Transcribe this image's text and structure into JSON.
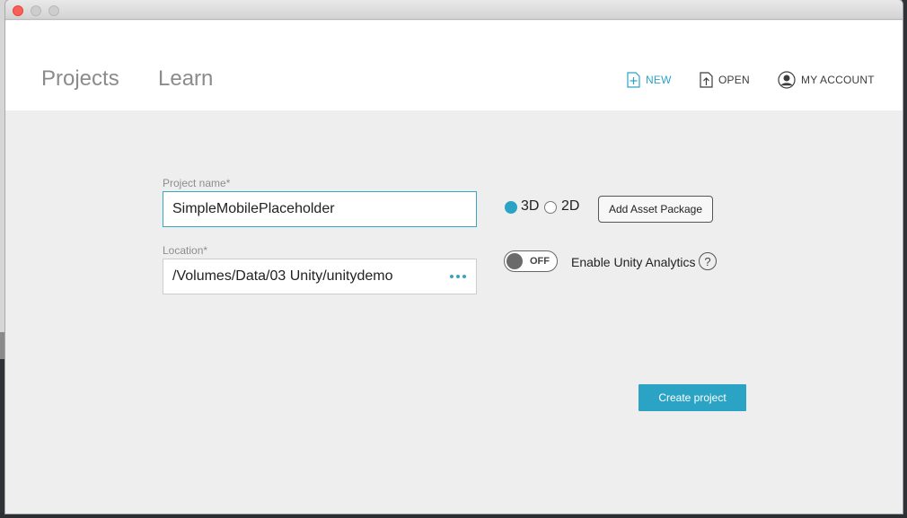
{
  "header": {
    "tabs": [
      {
        "label": "Projects"
      },
      {
        "label": "Learn"
      }
    ],
    "actions": {
      "new_label": "NEW",
      "open_label": "OPEN",
      "account_label": "MY ACCOUNT"
    }
  },
  "form": {
    "project_name_label": "Project name*",
    "project_name_value": "SimpleMobilePlaceholder",
    "location_label": "Location*",
    "location_value": "/Volumes/Data/03 Unity/unitydemo",
    "mode_3d_label": "3D",
    "mode_2d_label": "2D",
    "selected_mode": "3D",
    "add_asset_label": "Add Asset Package",
    "analytics_toggle_state": "OFF",
    "analytics_label": "Enable Unity Analytics",
    "help_label": "?",
    "create_label": "Create project"
  },
  "colors": {
    "accent": "#2ba3c4"
  },
  "icons": [
    "new-icon",
    "open-icon",
    "account-icon"
  ]
}
